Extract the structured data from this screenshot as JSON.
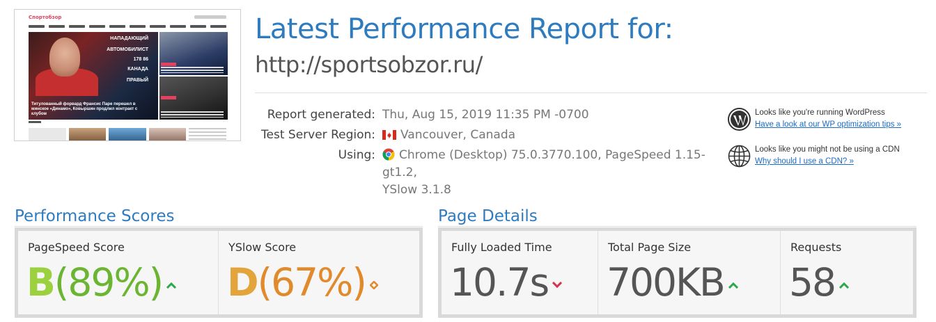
{
  "thumbnail": {
    "logo": "Спортобзор",
    "hero_stats": [
      "НАПАДАЮЩИЙ",
      "АВТОМОБИЛИСТ",
      "178  86",
      "КАНАДА",
      "ПРАВЫЙ"
    ],
    "hero_caption": "Титулованный форвард Франсис Паре перешел в минское «Динамо», Ковыршин продлил контракт с клубом",
    "row_label": "ФУТБОЛ"
  },
  "header": {
    "title": "Latest Performance Report for:",
    "url": "http://sportsobzor.ru/"
  },
  "report_info": {
    "generated_label": "Report generated:",
    "generated_value": "Thu, Aug 15, 2019 11:35 PM -0700",
    "region_label": "Test Server Region:",
    "region_value": "Vancouver, Canada",
    "using_label": "Using:",
    "using_value_line1": "Chrome (Desktop) 75.0.3770.100, PageSpeed 1.15-gt1.2,",
    "using_value_line2": "YSlow 3.1.8"
  },
  "tips": [
    {
      "icon": "wordpress-icon",
      "text": "Looks like you're running WordPress",
      "link": "Have a look at our WP optimization tips »"
    },
    {
      "icon": "globe-icon",
      "text": "Looks like you might not be using a CDN",
      "link": "Why should I use a CDN? »"
    }
  ],
  "performance_scores": {
    "title": "Performance Scores",
    "pagespeed": {
      "label": "PageSpeed Score",
      "grade": "B",
      "percent": "(89%)",
      "trend": "up",
      "color": "#6cb533"
    },
    "yslow": {
      "label": "YSlow Score",
      "grade": "D",
      "percent": "(67%)",
      "trend": "neutral",
      "color": "#e08a2c"
    }
  },
  "page_details": {
    "title": "Page Details",
    "load_time": {
      "label": "Fully Loaded Time",
      "value": "10.7s",
      "trend": "down"
    },
    "page_size": {
      "label": "Total Page Size",
      "value": "700KB",
      "trend": "up"
    },
    "requests": {
      "label": "Requests",
      "value": "58",
      "trend": "up"
    }
  },
  "colors": {
    "accent": "#2f7bbf",
    "up": "#2aa84a",
    "down": "#d9304f",
    "neutral": "#e08a2c"
  }
}
